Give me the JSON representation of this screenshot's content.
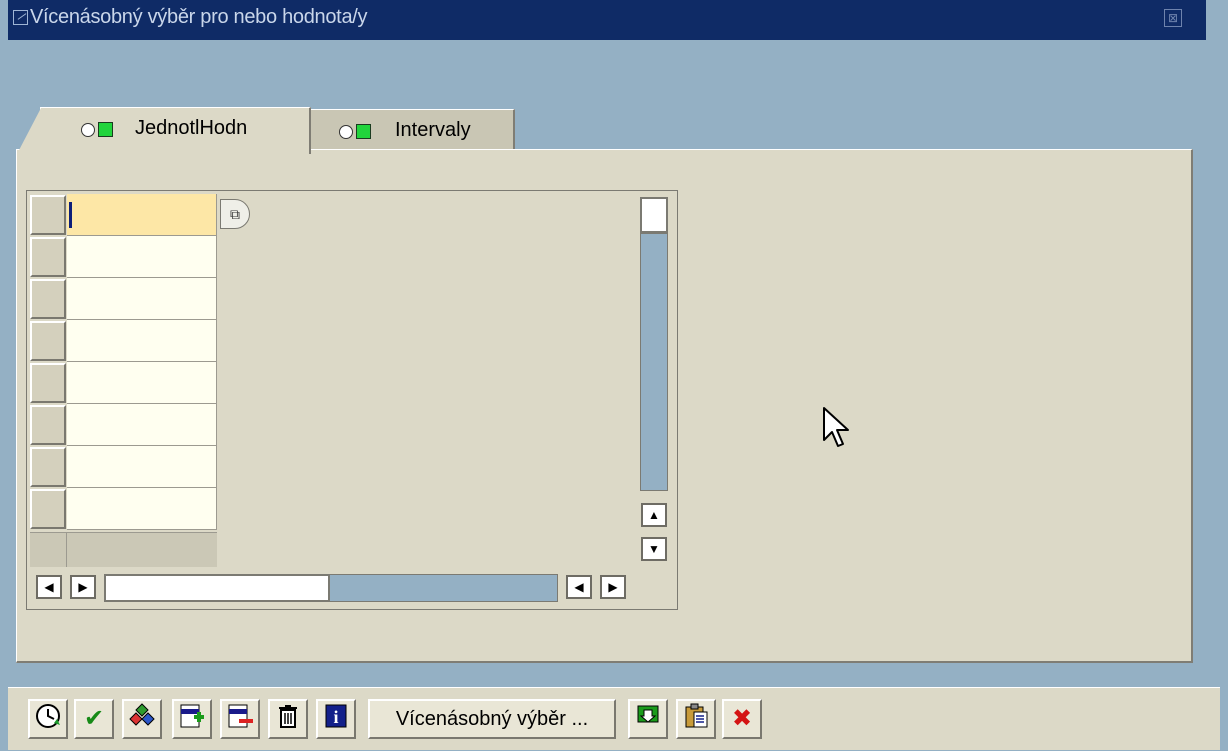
{
  "window": {
    "title": "Vícenásobný výběr pro nebo hodnota/y",
    "close_glyph": "⊠"
  },
  "tabs": [
    {
      "label": "JednotlHodn",
      "active": true,
      "icon": "status-circle-square-icon"
    },
    {
      "label": "Intervaly",
      "active": false,
      "icon": "status-circle-square-icon"
    }
  ],
  "grid": {
    "rows": [
      "",
      "",
      "",
      "",
      "",
      "",
      "",
      ""
    ],
    "multi_select_glyph": "⧉"
  },
  "scroll": {
    "up": "▲",
    "down": "▼",
    "left": "◀",
    "right": "▶"
  },
  "toolbar": {
    "buttons": [
      {
        "name": "execute-button",
        "icon": "clock-icon",
        "glyph": "⏲"
      },
      {
        "name": "copy-button",
        "icon": "checkmark-icon",
        "glyph": "✔"
      },
      {
        "name": "selection-options-button",
        "icon": "diamonds-icon",
        "glyph": "✦"
      },
      {
        "name": "insert-row-button",
        "icon": "insert-line-icon",
        "glyph": "⊞"
      },
      {
        "name": "delete-row-button",
        "icon": "delete-line-icon",
        "glyph": "⊟"
      },
      {
        "name": "delete-all-button",
        "icon": "trash-icon",
        "glyph": "🗑"
      },
      {
        "name": "help-button",
        "icon": "info-icon",
        "glyph": "i"
      }
    ],
    "multi_select_label": "Vícenásobný výběr ...",
    "extra_buttons": [
      {
        "name": "import-button",
        "icon": "import-icon",
        "glyph": "◘"
      },
      {
        "name": "paste-clipboard-button",
        "icon": "clipboard-icon",
        "glyph": "📋"
      },
      {
        "name": "cancel-button",
        "icon": "close-x-icon",
        "glyph": "✖"
      }
    ]
  },
  "colors": {
    "title_bar": "#0f2b66",
    "panel": "#dcd9c7",
    "desktop": "#94b0c4",
    "focused_cell": "#fde7a6",
    "cell": "#fffff0"
  }
}
